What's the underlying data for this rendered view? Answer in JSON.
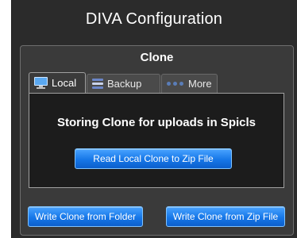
{
  "window": {
    "title": "DIVA Configuration"
  },
  "group": {
    "title": "Clone"
  },
  "tabs": [
    {
      "label": "Local",
      "icon": "monitor-icon",
      "selected": true
    },
    {
      "label": "Backup",
      "icon": "backup-icon",
      "selected": false
    },
    {
      "label": "More",
      "icon": "more-icon",
      "selected": false
    }
  ],
  "local_tab": {
    "heading": "Storing Clone for uploads in Spicls",
    "read_button_label": "Read Local Clone to Zip File"
  },
  "footer": {
    "write_folder_label": "Write Clone from Folder",
    "write_zip_label": "Write Clone from Zip File"
  },
  "colors": {
    "panel_background": "#2b2b2b",
    "group_background": "#3a3a3a",
    "content_background": "#1c1c1c",
    "button_blue": "#1677e8",
    "text": "#ffffff"
  }
}
